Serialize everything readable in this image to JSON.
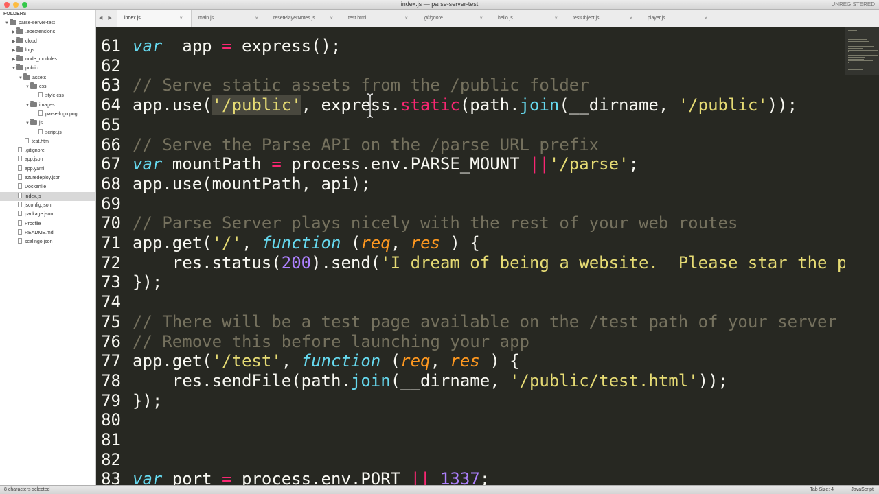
{
  "window": {
    "title": "index.js — parse-server-test",
    "badge": "UNREGISTERED",
    "traffic_colors": [
      "#fc605c",
      "#fdbc40",
      "#34c84a"
    ]
  },
  "sidebar": {
    "header": "FOLDERS",
    "items": [
      {
        "label": "parse-server-test",
        "type": "folder",
        "depth": 0,
        "expanded": true
      },
      {
        "label": ".ebextensions",
        "type": "folder",
        "depth": 1,
        "expanded": false
      },
      {
        "label": "cloud",
        "type": "folder",
        "depth": 1,
        "expanded": false
      },
      {
        "label": "logs",
        "type": "folder",
        "depth": 1,
        "expanded": false
      },
      {
        "label": "node_modules",
        "type": "folder",
        "depth": 1,
        "expanded": false
      },
      {
        "label": "public",
        "type": "folder",
        "depth": 1,
        "expanded": true
      },
      {
        "label": "assets",
        "type": "folder",
        "depth": 2,
        "expanded": true
      },
      {
        "label": "css",
        "type": "folder",
        "depth": 3,
        "expanded": true
      },
      {
        "label": "style.css",
        "type": "file",
        "depth": 4
      },
      {
        "label": "images",
        "type": "folder",
        "depth": 3,
        "expanded": true
      },
      {
        "label": "parse-logo.png",
        "type": "file",
        "depth": 4
      },
      {
        "label": "js",
        "type": "folder",
        "depth": 3,
        "expanded": true
      },
      {
        "label": "script.js",
        "type": "file",
        "depth": 4
      },
      {
        "label": "test.html",
        "type": "file",
        "depth": 2
      },
      {
        "label": ".gitignore",
        "type": "file",
        "depth": 1
      },
      {
        "label": "app.json",
        "type": "file",
        "depth": 1
      },
      {
        "label": "app.yaml",
        "type": "file",
        "depth": 1
      },
      {
        "label": "azuredeploy.json",
        "type": "file",
        "depth": 1
      },
      {
        "label": "Dockerfile",
        "type": "file",
        "depth": 1
      },
      {
        "label": "index.js",
        "type": "file",
        "depth": 1,
        "selected": true
      },
      {
        "label": "jsconfig.json",
        "type": "file",
        "depth": 1
      },
      {
        "label": "package.json",
        "type": "file",
        "depth": 1
      },
      {
        "label": "Procfile",
        "type": "file",
        "depth": 1
      },
      {
        "label": "README.md",
        "type": "file",
        "depth": 1
      },
      {
        "label": "scalingo.json",
        "type": "file",
        "depth": 1
      }
    ]
  },
  "tabs": {
    "nav_left": "◀",
    "nav_right": "▶",
    "close_glyph": "×",
    "items": [
      {
        "label": "index.js",
        "active": true,
        "italic": false
      },
      {
        "label": "main.js",
        "active": false,
        "italic": false
      },
      {
        "label": "resetPlayerNotes.js",
        "active": false,
        "italic": false
      },
      {
        "label": "test.html",
        "active": false,
        "italic": false
      },
      {
        "label": ".gitignore",
        "active": false,
        "italic": true
      },
      {
        "label": "hello.js",
        "active": false,
        "italic": false
      },
      {
        "label": "testObject.js",
        "active": false,
        "italic": false
      },
      {
        "label": "player.js",
        "active": false,
        "italic": false
      }
    ]
  },
  "editor": {
    "lines": [
      {
        "n": "61",
        "t": [
          [
            "kw-storage",
            "var"
          ],
          [
            "",
            "  app "
          ],
          [
            "op",
            "="
          ],
          [
            "",
            " express();"
          ]
        ]
      },
      {
        "n": "62",
        "t": []
      },
      {
        "n": "63",
        "t": [
          [
            "cm",
            "// Serve static assets from the /public folder"
          ]
        ]
      },
      {
        "n": "64",
        "t": [
          [
            "",
            "app.use("
          ],
          [
            "str sel",
            "'/public'"
          ],
          [
            "",
            ", express."
          ],
          [
            "op",
            "static"
          ],
          [
            "",
            "(path."
          ],
          [
            "fn",
            "join"
          ],
          [
            "",
            "(__dirname, "
          ],
          [
            "str",
            "'/public'"
          ],
          [
            "",
            "));"
          ]
        ]
      },
      {
        "n": "65",
        "t": []
      },
      {
        "n": "66",
        "t": [
          [
            "cm",
            "// Serve the Parse API on the /parse URL prefix"
          ]
        ]
      },
      {
        "n": "67",
        "t": [
          [
            "kw-storage",
            "var"
          ],
          [
            "",
            " mountPath "
          ],
          [
            "op",
            "="
          ],
          [
            "",
            " process.env.PARSE_MOUNT "
          ],
          [
            "op",
            "||"
          ],
          [
            "",
            "",
            " "
          ],
          [
            "str",
            "'/parse'"
          ],
          [
            "",
            ";"
          ]
        ]
      },
      {
        "n": "68",
        "t": [
          [
            "",
            "app.use(mountPath, api);"
          ]
        ]
      },
      {
        "n": "69",
        "t": []
      },
      {
        "n": "70",
        "t": [
          [
            "cm",
            "// Parse Server plays nicely with the rest of your web routes"
          ]
        ]
      },
      {
        "n": "71",
        "t": [
          [
            "",
            "app.get("
          ],
          [
            "str",
            "'/'"
          ],
          [
            "",
            ", "
          ],
          [
            "kw-storage",
            "function"
          ],
          [
            "",
            " ("
          ],
          [
            "param",
            "req"
          ],
          [
            "",
            ", "
          ],
          [
            "param",
            "res"
          ],
          [
            "",
            " ) {"
          ]
        ]
      },
      {
        "n": "72",
        "t": [
          [
            "",
            "    res.status("
          ],
          [
            "num",
            "200"
          ],
          [
            "",
            ").send("
          ],
          [
            "str",
            "'I dream of being a website.  Please star the p"
          ]
        ]
      },
      {
        "n": "73",
        "t": [
          [
            "",
            "});"
          ]
        ]
      },
      {
        "n": "74",
        "t": []
      },
      {
        "n": "75",
        "t": [
          [
            "cm",
            "// There will be a test page available on the /test path of your server"
          ]
        ]
      },
      {
        "n": "76",
        "t": [
          [
            "cm",
            "// Remove this before launching your app"
          ]
        ]
      },
      {
        "n": "77",
        "t": [
          [
            "",
            "app.get("
          ],
          [
            "str",
            "'/test'"
          ],
          [
            "",
            ", "
          ],
          [
            "kw-storage",
            "function"
          ],
          [
            "",
            " ("
          ],
          [
            "param",
            "req"
          ],
          [
            "",
            ", "
          ],
          [
            "param",
            "res"
          ],
          [
            "",
            " ) {"
          ]
        ]
      },
      {
        "n": "78",
        "t": [
          [
            "",
            "    res.sendFile(path."
          ],
          [
            "fn",
            "join"
          ],
          [
            "",
            "(__dirname, "
          ],
          [
            "str",
            "'/public/test.html'"
          ],
          [
            "",
            "));"
          ]
        ]
      },
      {
        "n": "79",
        "t": [
          [
            "",
            "});"
          ]
        ]
      },
      {
        "n": "80",
        "t": []
      },
      {
        "n": "81",
        "t": []
      },
      {
        "n": "82",
        "t": []
      },
      {
        "n": "83",
        "t": [
          [
            "kw-storage",
            "var"
          ],
          [
            "",
            " port "
          ],
          [
            "op",
            "="
          ],
          [
            "",
            " process.env.PORT "
          ],
          [
            "op",
            "||"
          ],
          [
            "",
            " "
          ],
          [
            "num",
            "1337"
          ],
          [
            "",
            ";"
          ]
        ]
      }
    ]
  },
  "status": {
    "selection": "8 characters selected",
    "tab_size": "Tab Size: 4",
    "syntax": "JavaScript"
  },
  "colors": {
    "editor_bg": "#272822",
    "comment": "#75715e",
    "string": "#e6db74",
    "keyword": "#f92672",
    "storage": "#66d9ef",
    "number": "#ae81ff",
    "parameter": "#fd971f"
  }
}
